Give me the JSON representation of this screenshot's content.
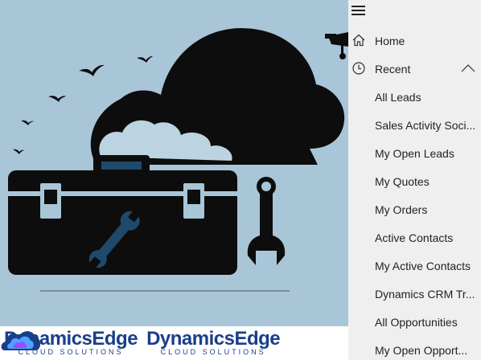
{
  "sidebar": {
    "menu_icon": "hamburger-icon",
    "home": {
      "label": "Home",
      "icon": "home-icon"
    },
    "recent": {
      "label": "Recent",
      "icon": "clock-icon",
      "expand_icon": "chevron-up-icon",
      "expanded": true
    },
    "recent_items": [
      {
        "label": "All Leads"
      },
      {
        "label": "Sales Activity Soci..."
      },
      {
        "label": "My Open Leads"
      },
      {
        "label": "My Quotes"
      },
      {
        "label": "My Orders"
      },
      {
        "label": "Active Contacts"
      },
      {
        "label": "My Active Contacts"
      },
      {
        "label": "Dynamics CRM Tr..."
      },
      {
        "label": "All Opportunities"
      },
      {
        "label": "My Open Opport..."
      }
    ]
  },
  "banner": {
    "logos": [
      {
        "name": "DynamicsEdge",
        "sub": "CLOUD SOLUTIONS"
      },
      {
        "name": "DynamicsEdge",
        "sub": "CLOUD SOLUTIONS"
      }
    ]
  },
  "colors": {
    "banner_bg": "#a9c6d8",
    "sidebar_bg": "#efefef",
    "brand": "#1a3f8a",
    "silhouette": "#0d0d0d",
    "wrench": "#1f4a6b"
  }
}
